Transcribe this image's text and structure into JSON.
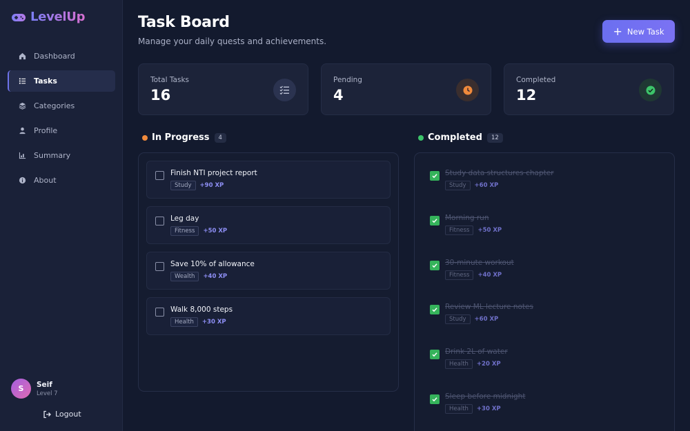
{
  "brand": {
    "name": "LevelUp"
  },
  "sidebar": {
    "items": [
      {
        "label": "Dashboard",
        "icon": "home-icon"
      },
      {
        "label": "Tasks",
        "icon": "tasks-icon",
        "active": true
      },
      {
        "label": "Categories",
        "icon": "layers-icon"
      },
      {
        "label": "Profile",
        "icon": "user-icon"
      },
      {
        "label": "Summary",
        "icon": "chart-icon"
      },
      {
        "label": "About",
        "icon": "info-icon"
      }
    ],
    "user": {
      "initial": "S",
      "name": "Seif",
      "level": "Level 7"
    },
    "logout_label": "Logout"
  },
  "header": {
    "title": "Task Board",
    "subtitle": "Manage your daily quests and achievements.",
    "new_task_label": "New Task"
  },
  "stats": [
    {
      "label": "Total Tasks",
      "value": "16",
      "icon": "checklist-icon"
    },
    {
      "label": "Pending",
      "value": "4",
      "icon": "clock-icon",
      "color": "#f08a3c"
    },
    {
      "label": "Completed",
      "value": "12",
      "icon": "check-circle-icon",
      "color": "#3cc46a"
    }
  ],
  "in_progress": {
    "title": "In Progress",
    "count": "4",
    "dot_color": "#f08a3c",
    "tasks": [
      {
        "title": "Finish NTI project report",
        "tag": "Study",
        "xp": "+90 XP"
      },
      {
        "title": "Leg day",
        "tag": "Fitness",
        "xp": "+50 XP"
      },
      {
        "title": "Save 10% of allowance",
        "tag": "Wealth",
        "xp": "+40 XP"
      },
      {
        "title": "Walk 8,000 steps",
        "tag": "Health",
        "xp": "+30 XP"
      }
    ]
  },
  "completed": {
    "title": "Completed",
    "count": "12",
    "dot_color": "#3cc46a",
    "tasks": [
      {
        "title": "Study data structures chapter",
        "tag": "Study",
        "xp": "+60 XP"
      },
      {
        "title": "Morning run",
        "tag": "Fitness",
        "xp": "+50 XP"
      },
      {
        "title": "30-minute workout",
        "tag": "Fitness",
        "xp": "+40 XP"
      },
      {
        "title": "Review ML lecture notes",
        "tag": "Study",
        "xp": "+60 XP"
      },
      {
        "title": "Drink 2L of water",
        "tag": "Health",
        "xp": "+20 XP"
      },
      {
        "title": "Sleep before midnight",
        "tag": "Health",
        "xp": "+30 XP"
      }
    ]
  }
}
